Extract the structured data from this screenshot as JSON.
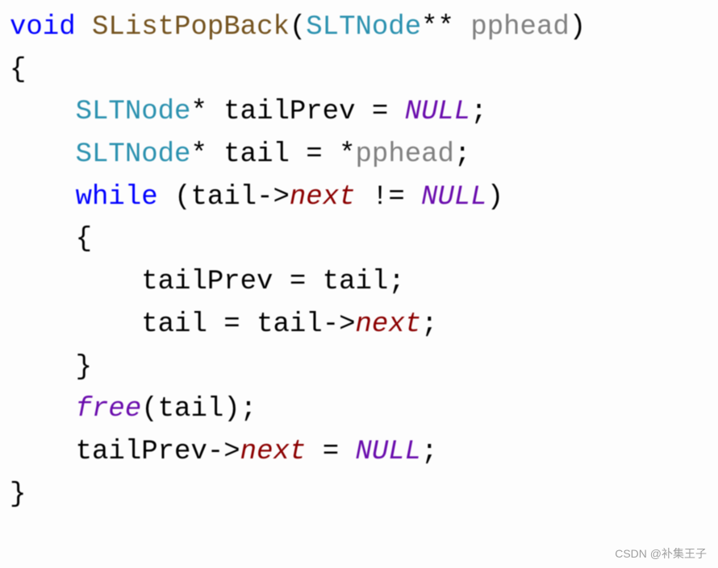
{
  "code": {
    "l1_kw": "void",
    "l1_sp1": " ",
    "l1_func": "SListPopBack",
    "l1_paren_open": "(",
    "l1_type": "SLTNode",
    "l1_stars": "**",
    "l1_sp2": " ",
    "l1_param": "pphead",
    "l1_paren_close": ")",
    "l2_brace_open": "{",
    "l3_indent": "    ",
    "l3_type": "SLTNode",
    "l3_star": "*",
    "l3_sp": " ",
    "l3_var": "tailPrev",
    "l3_eq": " = ",
    "l3_null": "NULL",
    "l3_semi": ";",
    "l4_indent": "    ",
    "l4_type": "SLTNode",
    "l4_star": "*",
    "l4_sp": " ",
    "l4_var": "tail",
    "l4_eq": " = *",
    "l4_param": "pphead",
    "l4_semi": ";",
    "l5_indent": "    ",
    "l5_kw": "while",
    "l5_sp": " ",
    "l5_paren_open": "(",
    "l5_var": "tail",
    "l5_arrow": "->",
    "l5_member": "next",
    "l5_ne": " != ",
    "l5_null": "NULL",
    "l5_paren_close": ")",
    "l6_indent": "    ",
    "l6_brace_open": "{",
    "l7_indent": "        ",
    "l7_var1": "tailPrev",
    "l7_eq": " = ",
    "l7_var2": "tail",
    "l7_semi": ";",
    "l8_indent": "        ",
    "l8_var1": "tail",
    "l8_eq": " = ",
    "l8_var2": "tail",
    "l8_arrow": "->",
    "l8_member": "next",
    "l8_semi": ";",
    "l9_indent": "    ",
    "l9_brace_close": "}",
    "l10_indent": "    ",
    "l10_free": "free",
    "l10_paren_open": "(",
    "l10_var": "tail",
    "l10_paren_close": ")",
    "l10_semi": ";",
    "l11_indent": "    ",
    "l11_var": "tailPrev",
    "l11_arrow": "->",
    "l11_member": "next",
    "l11_eq": " = ",
    "l11_null": "NULL",
    "l11_semi": ";",
    "l12_brace_close": "}"
  },
  "watermark": "CSDN @补集王子"
}
